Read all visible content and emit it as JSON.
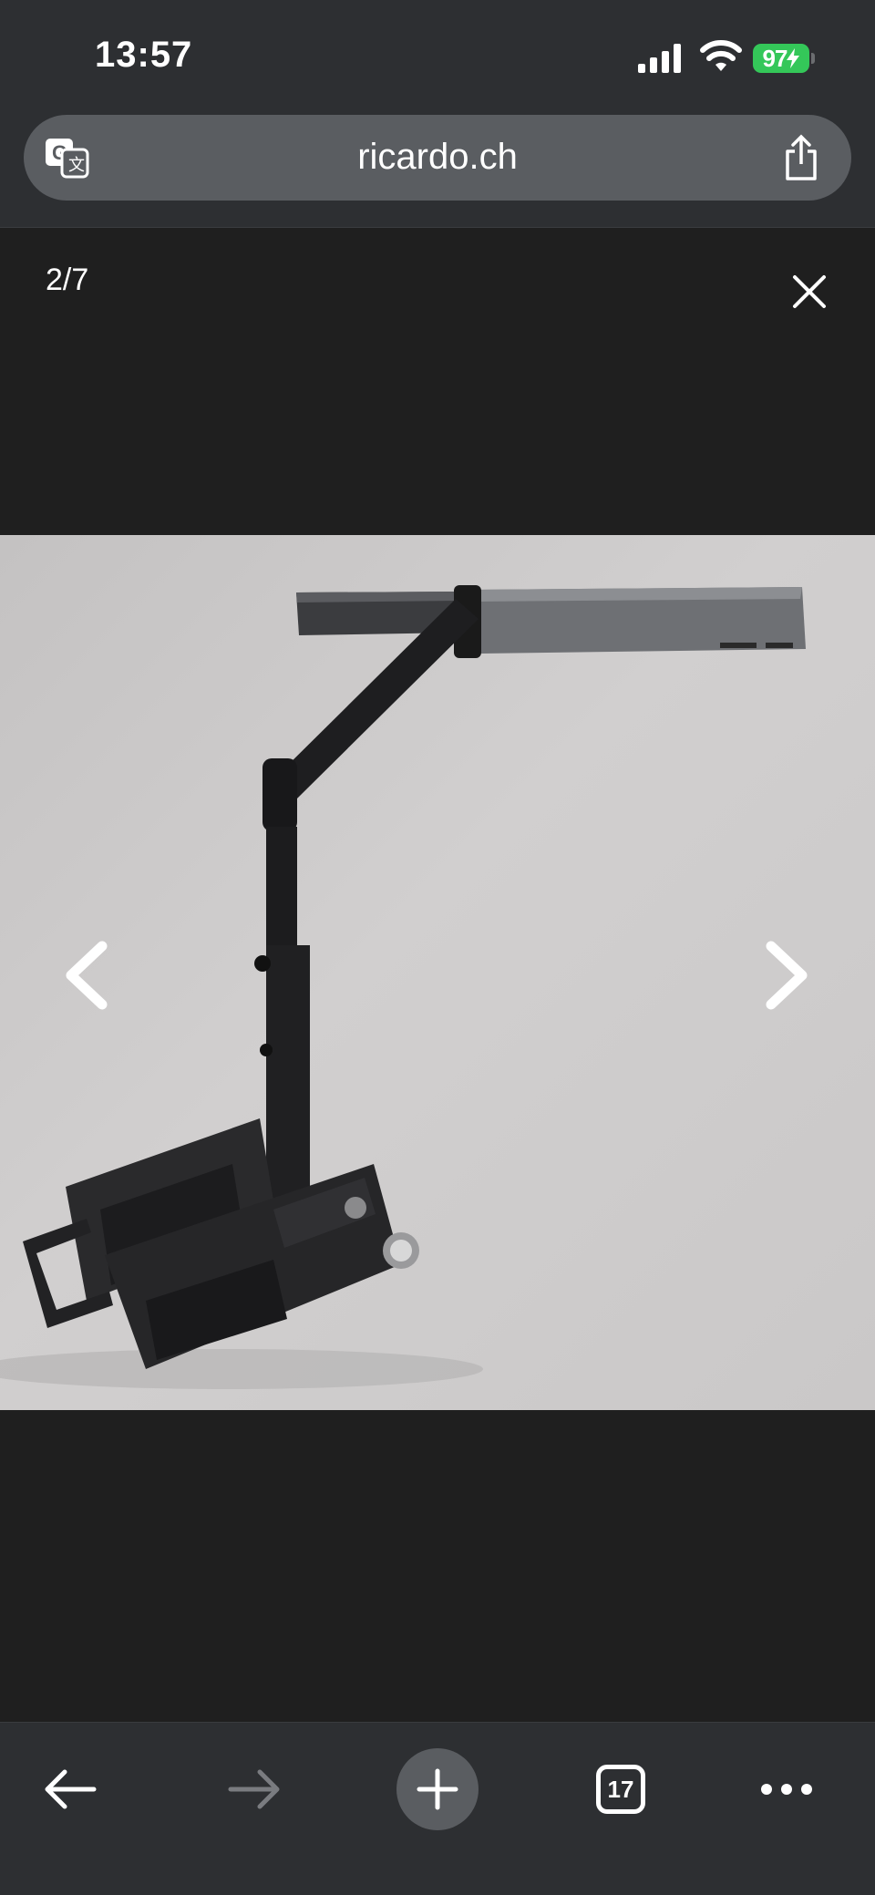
{
  "status_bar": {
    "time": "13:57",
    "battery": "97",
    "icons": [
      "signal-icon",
      "wifi-icon",
      "battery-icon"
    ]
  },
  "browser": {
    "url": "ricardo.ch",
    "icons": [
      "translate-icon",
      "share-icon"
    ]
  },
  "viewer": {
    "counter": "2/7",
    "icons": [
      "close-icon",
      "chevron-left-icon",
      "chevron-right-icon"
    ]
  },
  "toolbar": {
    "tab_count": "17",
    "icons": [
      "back-arrow-icon",
      "forward-arrow-icon",
      "plus-icon",
      "tabs-icon",
      "more-icon"
    ]
  },
  "colors": {
    "chrome": "#2d2f32",
    "viewer_bg": "#1f1f1f",
    "pill": "#5a5d61",
    "battery": "#34c759"
  }
}
